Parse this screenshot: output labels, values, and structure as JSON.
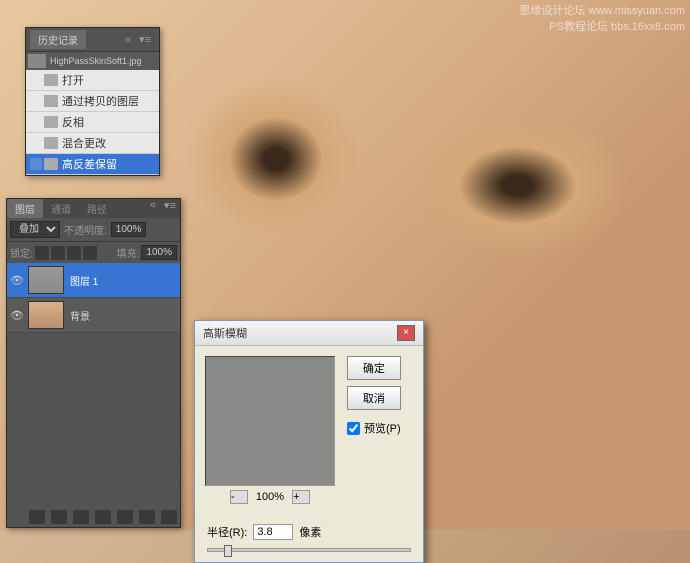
{
  "watermark": {
    "line1": "思缘设计论坛  www.missyuan.com",
    "line2": "PS教程论坛",
    "line3": "bbs.16xx8.com"
  },
  "history": {
    "title": "历史记录",
    "filename": "HighPassSkinSoft1.jpg",
    "items": [
      {
        "label": "打开"
      },
      {
        "label": "通过拷贝的图层"
      },
      {
        "label": "反相"
      },
      {
        "label": "混合更改"
      },
      {
        "label": "高反差保留",
        "selected": true
      }
    ]
  },
  "layers": {
    "tabs": {
      "layers": "图层",
      "channels": "通道",
      "paths": "路径"
    },
    "blend_mode": "叠加",
    "opacity_label": "不透明度:",
    "opacity_value": "100%",
    "lock_label": "锁定:",
    "fill_label": "填充:",
    "fill_value": "100%",
    "items": [
      {
        "name": "图层 1",
        "selected": true,
        "thumb": "grey"
      },
      {
        "name": "背景",
        "selected": false,
        "thumb": "face"
      }
    ]
  },
  "dialog": {
    "title": "高斯模糊",
    "ok": "确定",
    "cancel": "取消",
    "preview": "预览(P)",
    "zoom": "100%",
    "radius_label": "半径(R):",
    "radius_value": "3.8",
    "radius_unit": "像素"
  }
}
